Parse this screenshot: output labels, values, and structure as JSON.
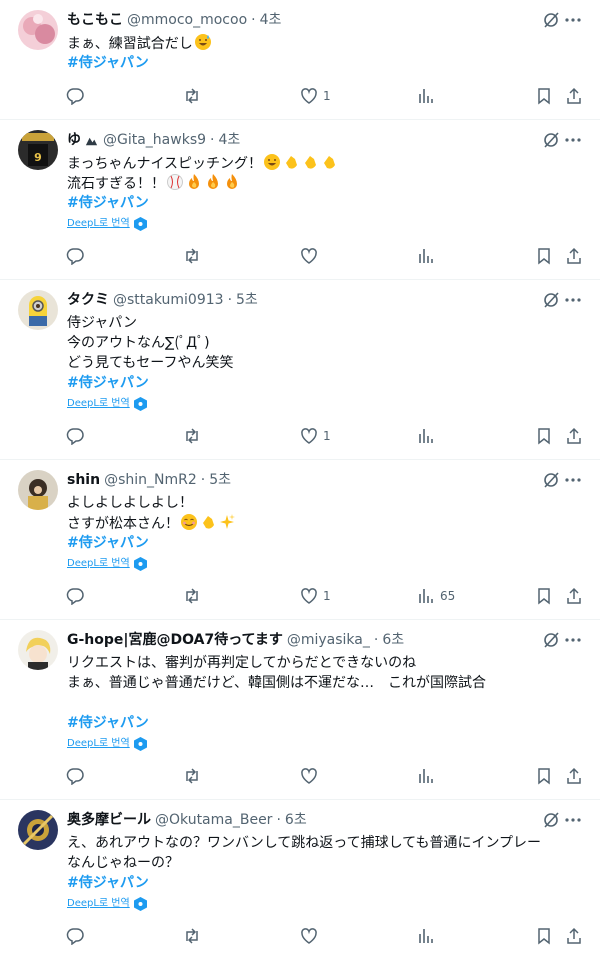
{
  "tweets": [
    {
      "name": "もこもこ",
      "handle": "@mmoco_mocoo",
      "time": "4초",
      "verified": false,
      "lines": [
        "まぁ、練習試合だし"
      ],
      "hashtag": "#侍ジャパン",
      "translate": null,
      "likes": "1",
      "views": ""
    },
    {
      "name": "ゆ",
      "handle": "@Gita_hawks9",
      "time": "4초",
      "verified": false,
      "lines": [
        "まっちゃんナイスピッチング！",
        "流石すぎる！！"
      ],
      "hashtag": "#侍ジャパン",
      "translate": "DeepL로 번역",
      "likes": "",
      "views": ""
    },
    {
      "name": "タクミ",
      "handle": "@sttakumi0913",
      "time": "5초",
      "verified": false,
      "lines": [
        "侍ジャパン",
        "今のアウトなん∑(ﾟДﾟ)",
        "どう見てもセーフやん笑笑"
      ],
      "hashtag": "#侍ジャパン",
      "translate": "DeepL로 번역",
      "likes": "1",
      "views": ""
    },
    {
      "name": "shin",
      "handle": "@shin_NmR2",
      "time": "5초",
      "verified": false,
      "lines": [
        "よしよしよしよし！",
        "さすが松本さん！"
      ],
      "hashtag": "#侍ジャパン",
      "translate": "DeepL로 번역",
      "likes": "1",
      "views": "65"
    },
    {
      "name": "G-hope|宮鹿@DOA7待ってます",
      "handle": "@miyasika_",
      "time": "6초",
      "verified": false,
      "lines": [
        "リクエストは、審判が再判定してからだとできないのね",
        "まぁ、普通じゃ普通だけど、韓国側は不運だな…　これが国際試合"
      ],
      "hashtag": "#侍ジャパン",
      "translate": "DeepL로 번역",
      "likes": "",
      "views": ""
    },
    {
      "name": "奥多摩ビール",
      "handle": "@Okutama_Beer",
      "time": "6초",
      "verified": false,
      "lines": [
        "え、あれアウトなの？ワンバンして跳ね返って捕球しても普通にインプレー",
        "なんじゃねーの？"
      ],
      "hashtag": "#侍ジャパン",
      "translate": "DeepL로 번역",
      "likes": "",
      "views": ""
    }
  ],
  "icons": {
    "reply": "reply-icon",
    "retweet": "retweet-icon",
    "like": "heart-icon",
    "views": "views-icon",
    "bookmark": "bookmark-icon",
    "share": "share-icon",
    "grok": "grok-icon",
    "more": "more-icon"
  },
  "colors": {
    "link": "#1d9bf0",
    "secondary": "#536471",
    "text": "#0f1419",
    "divider": "#eff3f4"
  }
}
